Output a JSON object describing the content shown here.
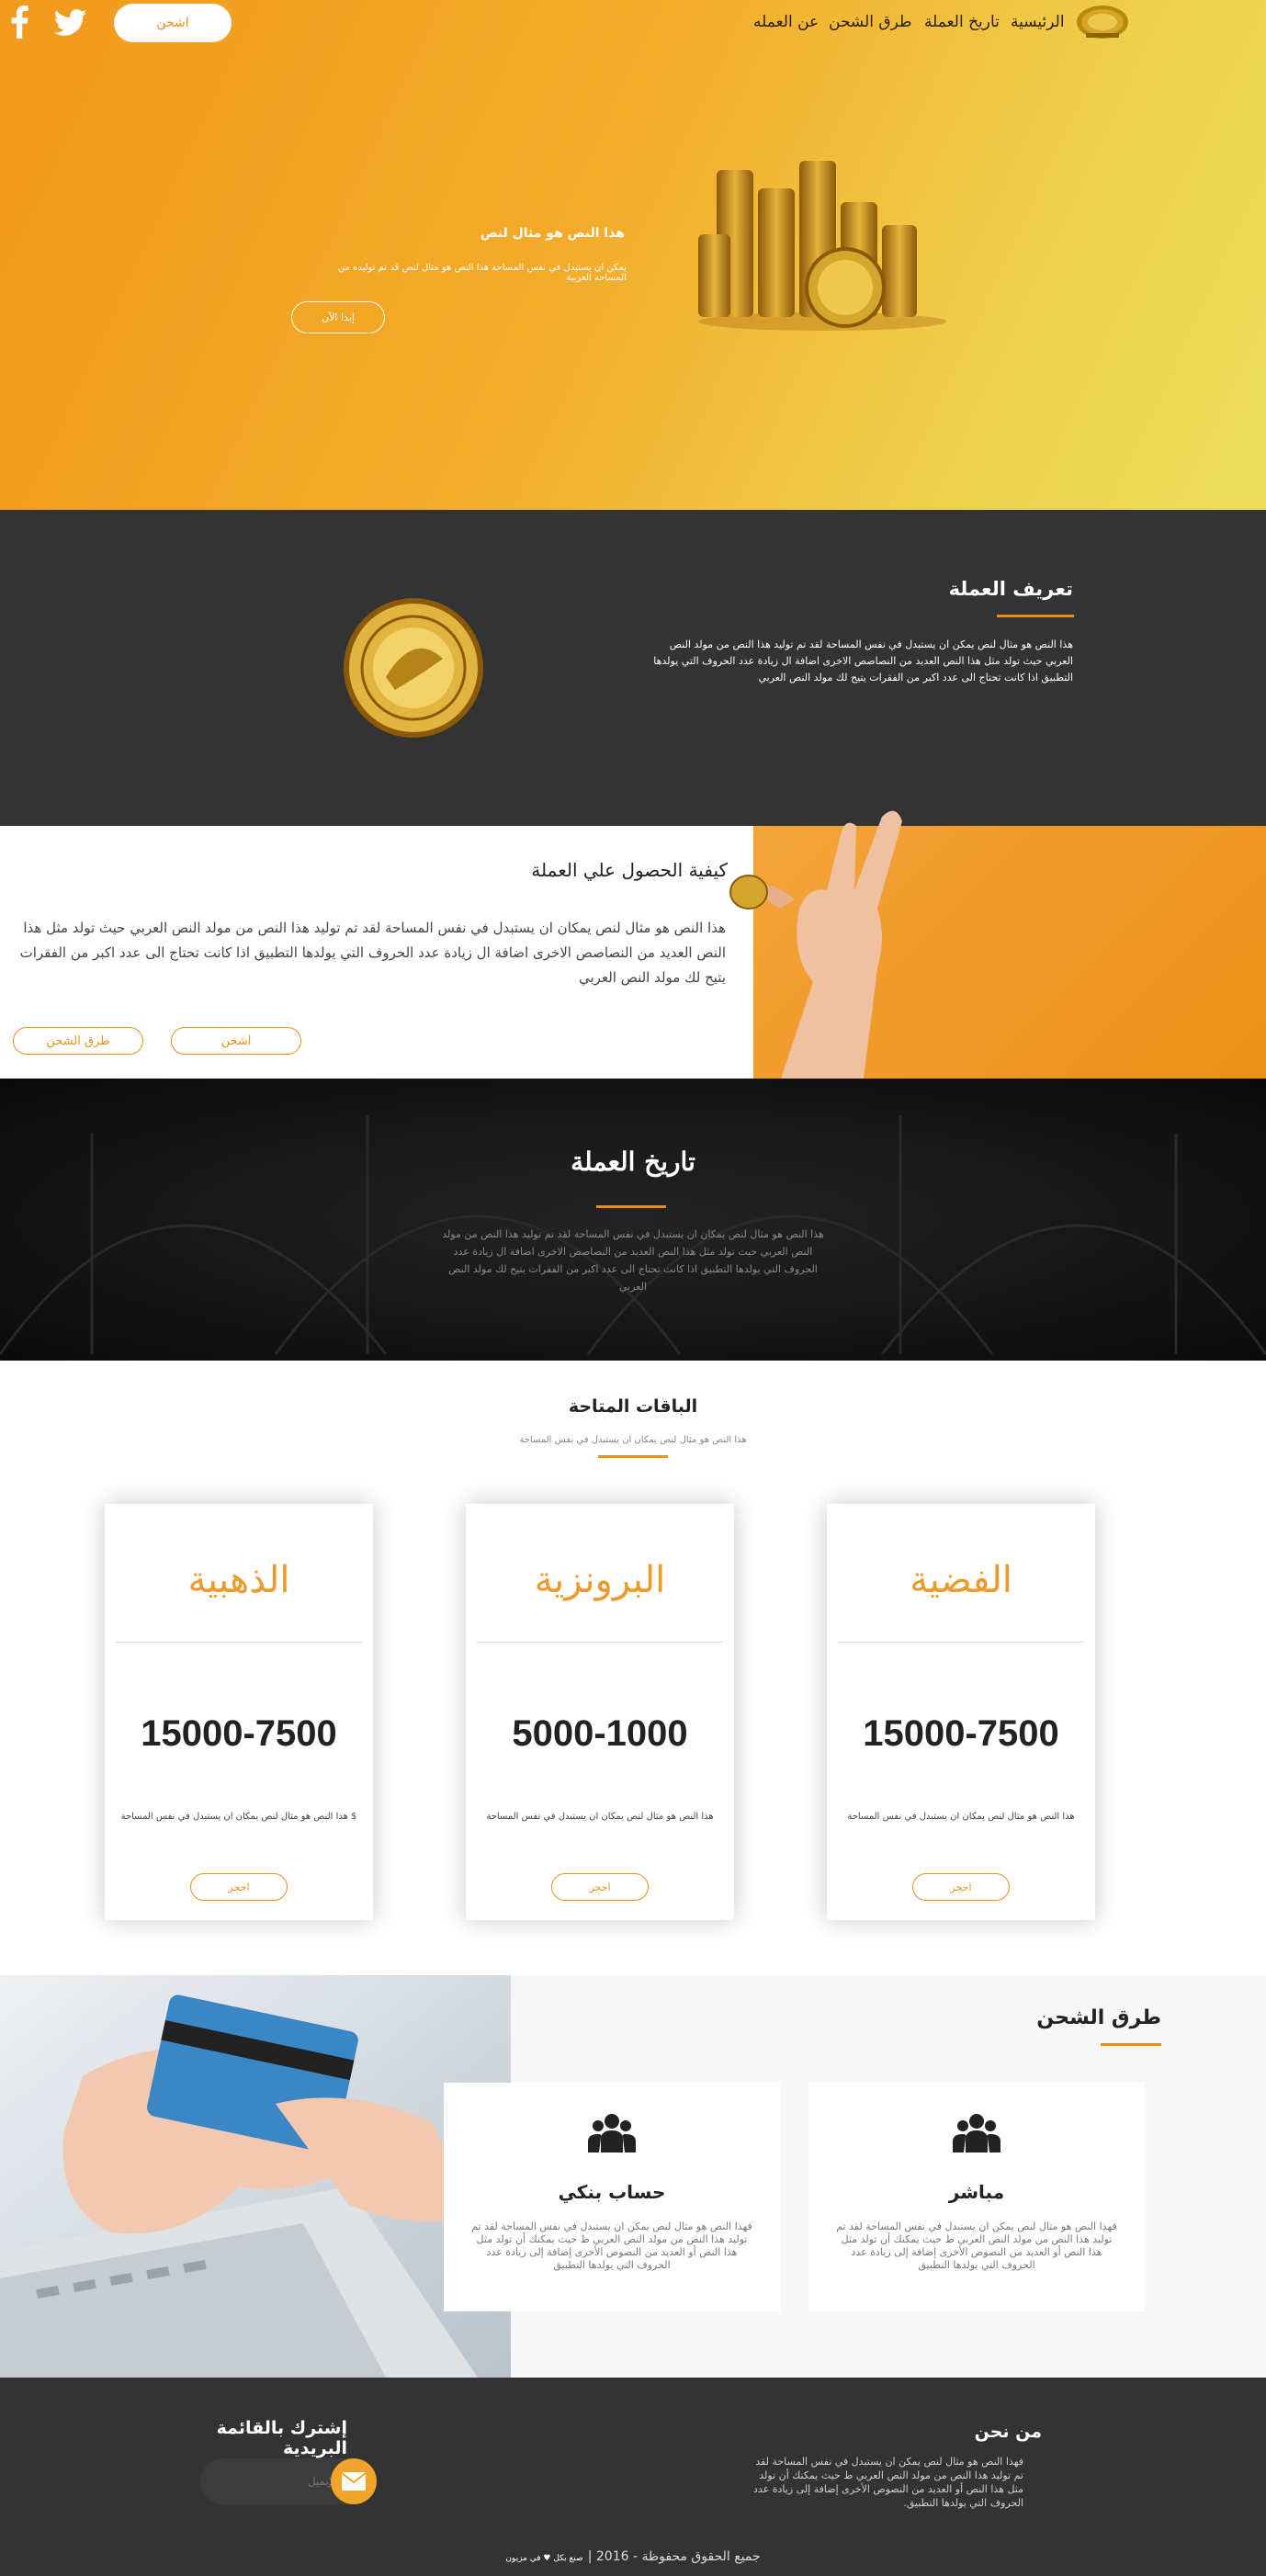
{
  "nav": {
    "items": [
      "الرئيسية",
      "تاريخ العملة",
      "طرق الشحن",
      "عن العمله"
    ],
    "cta_label": "اشحن",
    "social": [
      "twitter-icon",
      "facebook-icon"
    ]
  },
  "hero": {
    "title": "هذا النص هو مثال لنص",
    "subtitle": "يمكن ان يستبدل في نفس المساحة هذا النص هو مثال لنص قد تم توليده من المساحة العربية",
    "button_label": "إبدا الآن"
  },
  "definition": {
    "title": "تعريف العملة",
    "text": "هذا النص هو مثال لنص يمكن ان يستبدل في نفس المساحة لقد تم توليد هذا النص من مولد النص العربي حيث تولد مثل هذا النص العديد من النصاصص الاخرى اضافة ال زيادة عدد الحروف التي يولدها التطبيق اذا كانت تحتاج الى عدد اكبر من الفقرات يتيح لك مولد النص العربي"
  },
  "how": {
    "title": "كيفية الحصول علي العملة",
    "text": "هذا النص هو مثال لنص يمكان ان يستبدل في نفس المساحة لقد تم توليد هذا النص من مولد النص العربي حيث تولد مثل هذا النص العديد من النصاصص الاخرى اضافة ال زيادة عدد الحروف التي يولدها التطبيق اذا كانت تحتاج الى عدد اكبر من الفقرات يتيح لك مولد النص العربي",
    "charge_label": "اشحن",
    "methods_label": "طرق الشحن"
  },
  "history": {
    "title": "تاريخ العملة",
    "text": "هذا النص هو مثال لنص يمكان ان يستبدل في نفس المساحة لقد تم توليد هذا النص من مولد النص العربي حيث تولد مثل هذا النص العديد من النصاصص الاخرى اضافة ال زيادة عدد الحروف التي يولدها التطبيق اذا كانت تحتاج الى عدد اكبر من الفقرات يتيح لك مولد النص العربي"
  },
  "packages": {
    "title": "الباقات المتاحة",
    "subtitle": "هذا النص هو مثال لنص يمكان ان يستبدل في نفس المساحة",
    "items": [
      {
        "name": "الذهبية",
        "price": "15000-7500",
        "desc": "$ هذا النص هو مثال لنص يمكان ان يستبدل في نفس المساحة",
        "button": "احجز"
      },
      {
        "name": "البرونزية",
        "price": "5000-1000",
        "desc": "هذا النص هو مثال لنص يمكان ان يستبدل في نفس المساحة",
        "button": "احجز"
      },
      {
        "name": "الفضية",
        "price": "15000-7500",
        "desc": "هذا النص هو مثال لنص يمكان ان يستبدل في نفس المساحة",
        "button": "احجز"
      }
    ]
  },
  "methods": {
    "title": "طرق الشحن",
    "items": [
      {
        "title": "حساب بنكي",
        "icon": "group-icon",
        "desc": "فهذا النص هو مثال لنص يمكن ان يستبدل في نفس المساحة لقد تم توليد هذا النص من مولد النص العربي ط حيث يمكنك أن تولد مثل هذا النص أو العديد من النصوص الأخرى إضافة إلى زيادة عدد الحروف التي يولدها التطبيق"
      },
      {
        "title": "مباشر",
        "icon": "group-icon",
        "desc": "فهذا النص هو مثال لنص يمكن ان يستبدل في نفس المساحة لقد تم توليد هذا النص من مولد النص العربي ط حيث يمكنك أن تولد مثل هذا النص أو العديد من النصوص الأخرى إضافة إلى زيادة عدد الحروف التي يولدها التطبيق"
      }
    ]
  },
  "footer": {
    "subscribe_title": "إشترك بالقائمة البريدية",
    "email_placeholder": "الإيميل",
    "about_title": "من نحن",
    "about_text": "فهذا النص هو مثال لنص يمكن ان يستبدل في نفس المساحة لقد تم توليد هذا النص من مولد النص العربي ط حيث يمكنك أن تولد مثل هذا النص أو العديد من النصوص الأخرى إضافة إلى زيادة عدد الحروف التي يولدها التطبيق.",
    "copyright": "جميع الحقوق محفوظة - 2016 |",
    "credit": "صنع بكل ♥ في مزيون"
  },
  "colors": {
    "accent": "#e8901a",
    "dark": "#333334",
    "gold": "#ee9a2a"
  }
}
